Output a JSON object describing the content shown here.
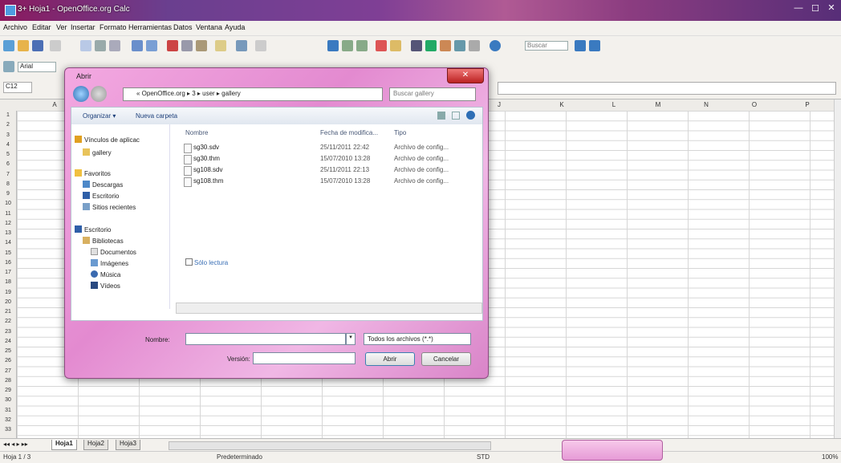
{
  "window": {
    "title": "3+ Hoja1 - OpenOffice.org Calc",
    "min": "—",
    "max": "☐",
    "close": "✕"
  },
  "menus": [
    "Archivo",
    "Editar",
    "Ver",
    "Insertar",
    "Formato",
    "Herramientas",
    "Datos",
    "Ventana",
    "Ayuda"
  ],
  "toolbar": {
    "find_placeholder": "Buscar",
    "font_name": "Arial"
  },
  "formula": {
    "name_box": "C12"
  },
  "columns": [
    "A",
    "",
    "",
    "",
    "",
    "",
    "",
    "",
    "",
    "J",
    "K",
    "L",
    "M",
    "N",
    "O",
    "P"
  ],
  "rows": [
    "1",
    "2",
    "3",
    "4",
    "5",
    "6",
    "7",
    "8",
    "9",
    "10",
    "11",
    "12",
    "13",
    "14",
    "15",
    "16",
    "17",
    "18",
    "19",
    "20",
    "21",
    "22",
    "23",
    "24",
    "25",
    "26",
    "27",
    "28",
    "29",
    "30",
    "31",
    "32",
    "33"
  ],
  "sheet_tabs": [
    "Hoja1",
    "Hoja2",
    "Hoja3"
  ],
  "status": {
    "page": "Hoja 1 / 3",
    "style": "Predeterminado",
    "mode": "STD",
    "zoom": "100%"
  },
  "dialog": {
    "title": "Abrir",
    "path": "« OpenOffice.org ▸ 3 ▸ user ▸ gallery",
    "search_placeholder": "Buscar gallery",
    "organize": "Organizar ▾",
    "new_folder": "Nueva carpeta",
    "nav": [
      "Vínculos de aplicac",
      "gallery",
      "Favoritos",
      "Descargas",
      "Escritorio",
      "Sitios recientes",
      "Escritorio",
      "Bibliotecas",
      "Documentos",
      "Imágenes",
      "Música",
      "Vídeos"
    ],
    "headers": {
      "name": "Nombre",
      "date": "Fecha de modifica...",
      "type": "Tipo"
    },
    "files": [
      {
        "name": "sg30.sdv",
        "date": "25/11/2011 22:42",
        "type": "Archivo de config..."
      },
      {
        "name": "sg30.thm",
        "date": "15/07/2010 13:28",
        "type": "Archivo de config..."
      },
      {
        "name": "sg108.sdv",
        "date": "25/11/2011 22:13",
        "type": "Archivo de config..."
      },
      {
        "name": "sg108.thm",
        "date": "15/07/2010 13:28",
        "type": "Archivo de config..."
      }
    ],
    "read_only": "Sólo lectura",
    "name_label": "Nombre:",
    "name_value": "",
    "filetype": "Todos los archivos (*.*)",
    "version_label": "Versión:",
    "open_label": "Abrir",
    "cancel_label": "Cancelar"
  }
}
